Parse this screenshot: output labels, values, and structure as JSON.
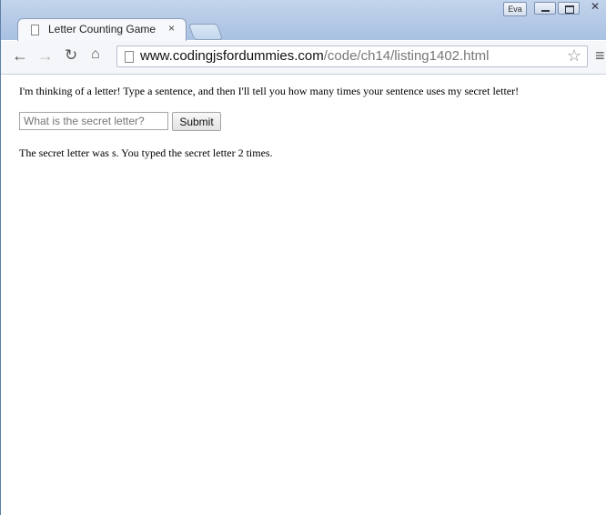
{
  "window": {
    "user_badge": "Eva",
    "tab_title": "Letter Counting Game",
    "tab_close": "×"
  },
  "toolbar": {
    "url_host": "www.codingjsfordummies.com",
    "url_path": "/code/ch14/listing1402.html"
  },
  "page": {
    "intro": "I'm thinking of a letter! Type a sentence, and then I'll tell you how many times your sentence uses my secret letter!",
    "input_placeholder": "What is the secret letter?",
    "submit_label": "Submit",
    "result": "The secret letter was s. You typed the secret letter 2 times."
  }
}
